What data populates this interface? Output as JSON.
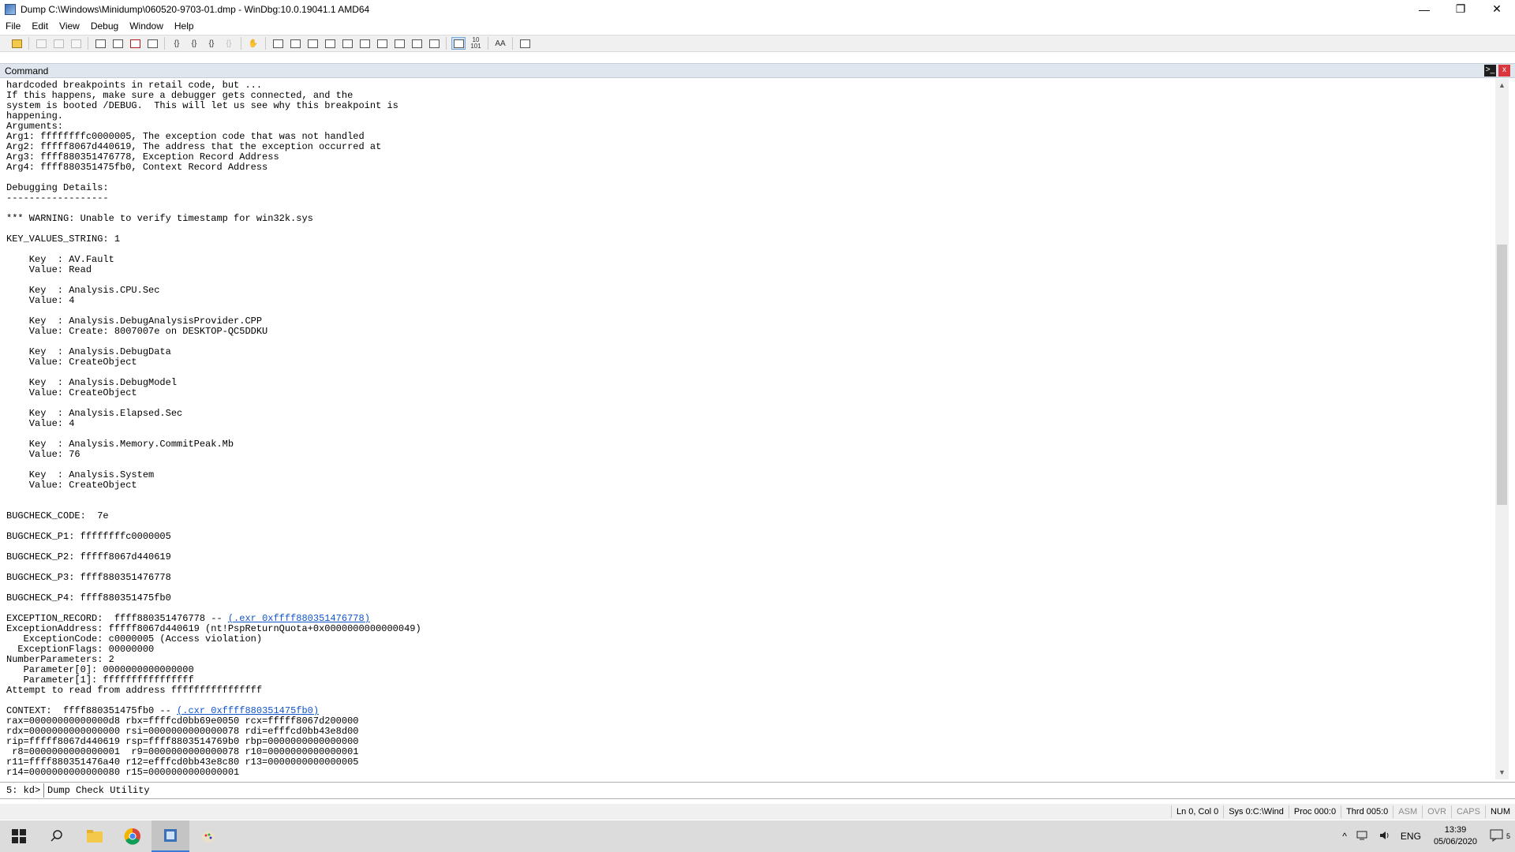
{
  "window": {
    "title": "Dump C:\\Windows\\Minidump\\060520-9703-01.dmp - WinDbg:10.0.19041.1 AMD64",
    "controls": {
      "minimize": "—",
      "maximize": "❐",
      "close": "✕"
    }
  },
  "menu": [
    "File",
    "Edit",
    "View",
    "Debug",
    "Window",
    "Help"
  ],
  "toolbar": {
    "icons": [
      {
        "name": "open-icon",
        "enabled": true
      },
      {
        "name": "cut-icon",
        "enabled": false
      },
      {
        "name": "copy-icon",
        "enabled": false
      },
      {
        "name": "paste-icon",
        "enabled": false
      },
      {
        "name": "go-icon",
        "enabled": true
      },
      {
        "name": "restart-icon",
        "enabled": true
      },
      {
        "name": "stop-debugging-icon",
        "enabled": true
      },
      {
        "name": "break-icon",
        "enabled": true
      },
      {
        "name": "step-into-icon",
        "enabled": true
      },
      {
        "name": "step-over-icon",
        "enabled": true
      },
      {
        "name": "step-out-icon",
        "enabled": true
      },
      {
        "name": "run-to-cursor-icon",
        "enabled": false
      },
      {
        "name": "insert-breakpoint-icon",
        "enabled": true
      },
      {
        "name": "command-window-icon",
        "enabled": true
      },
      {
        "name": "watch-window-icon",
        "enabled": true
      },
      {
        "name": "locals-window-icon",
        "enabled": true
      },
      {
        "name": "registers-window-icon",
        "enabled": true
      },
      {
        "name": "memory-window-icon",
        "enabled": true
      },
      {
        "name": "call-stack-window-icon",
        "enabled": true
      },
      {
        "name": "disassembly-window-icon",
        "enabled": true
      },
      {
        "name": "scratch-pad-icon",
        "enabled": true
      },
      {
        "name": "processes-threads-icon",
        "enabled": true
      },
      {
        "name": "source-mode-icon",
        "enabled": true,
        "selected": true
      },
      {
        "name": "hex-mode-icon",
        "enabled": true
      },
      {
        "name": "font-icon",
        "enabled": true
      },
      {
        "name": "options-icon",
        "enabled": true
      }
    ],
    "hex_mode_label": "10\n101",
    "font_label": "AA"
  },
  "command_window": {
    "title": "Command",
    "header_buttons": {
      "terminal": ">_",
      "close": "x"
    },
    "output_lines": [
      {
        "text": "hardcoded breakpoints in retail code, but ..."
      },
      {
        "text": "If this happens, make sure a debugger gets connected, and the"
      },
      {
        "text": "system is booted /DEBUG.  This will let us see why this breakpoint is"
      },
      {
        "text": "happening."
      },
      {
        "text": "Arguments:"
      },
      {
        "text": "Arg1: ffffffffc0000005, The exception code that was not handled"
      },
      {
        "text": "Arg2: fffff8067d440619, The address that the exception occurred at"
      },
      {
        "text": "Arg3: ffff880351476778, Exception Record Address"
      },
      {
        "text": "Arg4: ffff880351475fb0, Context Record Address"
      },
      {
        "text": ""
      },
      {
        "text": "Debugging Details:"
      },
      {
        "text": "------------------"
      },
      {
        "text": ""
      },
      {
        "text": "*** WARNING: Unable to verify timestamp for win32k.sys"
      },
      {
        "text": ""
      },
      {
        "text": "KEY_VALUES_STRING: 1"
      },
      {
        "text": ""
      },
      {
        "text": "    Key  : AV.Fault"
      },
      {
        "text": "    Value: Read"
      },
      {
        "text": ""
      },
      {
        "text": "    Key  : Analysis.CPU.Sec"
      },
      {
        "text": "    Value: 4"
      },
      {
        "text": ""
      },
      {
        "text": "    Key  : Analysis.DebugAnalysisProvider.CPP"
      },
      {
        "text": "    Value: Create: 8007007e on DESKTOP-QC5DDKU"
      },
      {
        "text": ""
      },
      {
        "text": "    Key  : Analysis.DebugData"
      },
      {
        "text": "    Value: CreateObject"
      },
      {
        "text": ""
      },
      {
        "text": "    Key  : Analysis.DebugModel"
      },
      {
        "text": "    Value: CreateObject"
      },
      {
        "text": ""
      },
      {
        "text": "    Key  : Analysis.Elapsed.Sec"
      },
      {
        "text": "    Value: 4"
      },
      {
        "text": ""
      },
      {
        "text": "    Key  : Analysis.Memory.CommitPeak.Mb"
      },
      {
        "text": "    Value: 76"
      },
      {
        "text": ""
      },
      {
        "text": "    Key  : Analysis.System"
      },
      {
        "text": "    Value: CreateObject"
      },
      {
        "text": ""
      },
      {
        "text": ""
      },
      {
        "text": "BUGCHECK_CODE:  7e"
      },
      {
        "text": ""
      },
      {
        "text": "BUGCHECK_P1: ffffffffc0000005"
      },
      {
        "text": ""
      },
      {
        "text": "BUGCHECK_P2: fffff8067d440619"
      },
      {
        "text": ""
      },
      {
        "text": "BUGCHECK_P3: ffff880351476778"
      },
      {
        "text": ""
      },
      {
        "text": "BUGCHECK_P4: ffff880351475fb0"
      },
      {
        "text": ""
      },
      {
        "text": "EXCEPTION_RECORD:  ffff880351476778 -- ",
        "link": "(.exr 0xffff880351476778)"
      },
      {
        "text": "ExceptionAddress: fffff8067d440619 (nt!PspReturnQuota+0x0000000000000049)"
      },
      {
        "text": "   ExceptionCode: c0000005 (Access violation)"
      },
      {
        "text": "  ExceptionFlags: 00000000"
      },
      {
        "text": "NumberParameters: 2"
      },
      {
        "text": "   Parameter[0]: 0000000000000000"
      },
      {
        "text": "   Parameter[1]: ffffffffffffffff"
      },
      {
        "text": "Attempt to read from address ffffffffffffffff"
      },
      {
        "text": ""
      },
      {
        "text": "CONTEXT:  ffff880351475fb0 -- ",
        "link": "(.cxr 0xffff880351475fb0)"
      },
      {
        "text": "rax=00000000000000d8 rbx=ffffcd0bb69e0050 rcx=fffff8067d200000"
      },
      {
        "text": "rdx=0000000000000000 rsi=0000000000000078 rdi=efffcd0bb43e8d00"
      },
      {
        "text": "rip=fffff8067d440619 rsp=ffff8803514769b0 rbp=0000000000000000"
      },
      {
        "text": " r8=0000000000000001  r9=0000000000000078 r10=0000000000000001"
      },
      {
        "text": "r11=ffff880351476a40 r12=efffcd0bb43e8c80 r13=0000000000000005"
      },
      {
        "text": "r14=0000000000000080 r15=0000000000000001"
      }
    ]
  },
  "command_input": {
    "prompt": "5: kd>",
    "value": "Dump Check Utility "
  },
  "status_bar": {
    "position": "Ln 0, Col 0",
    "system": "Sys 0:C:\\Wind",
    "process": "Proc 000:0",
    "thread": "Thrd 005:0",
    "asm": "ASM",
    "ovr": "OVR",
    "caps": "CAPS",
    "num": "NUM"
  },
  "taskbar": {
    "apps": [
      "start-button",
      "search-icon",
      "file-explorer-icon",
      "chrome-icon",
      "windbg-icon",
      "paint-icon"
    ],
    "tray": {
      "chevron": "^",
      "lang": "ENG",
      "time": "13:39",
      "date": "05/06/2020",
      "notifications": "5"
    }
  }
}
